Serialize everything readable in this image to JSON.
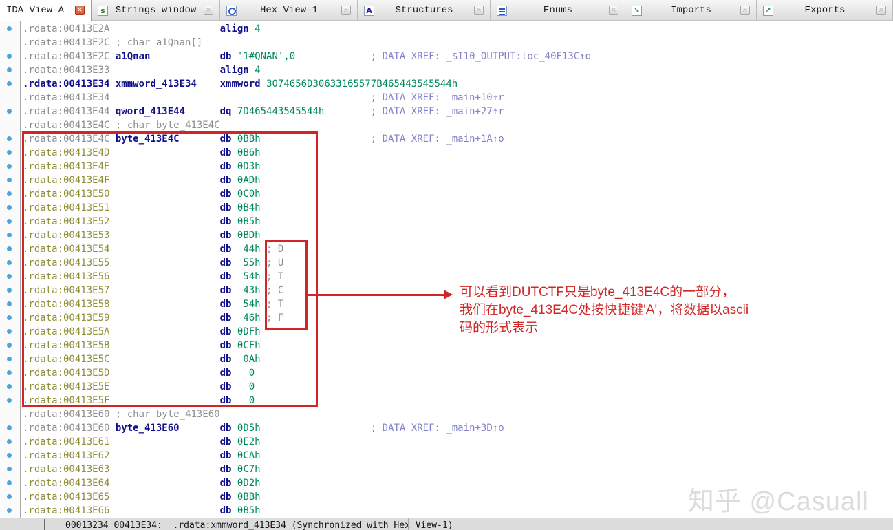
{
  "tabs": [
    {
      "label": "IDA View-A",
      "active": true
    },
    {
      "label": "Strings window",
      "active": false
    },
    {
      "label": "Hex View-1",
      "active": false
    },
    {
      "label": "Structures",
      "active": false
    },
    {
      "label": "Enums",
      "active": false
    },
    {
      "label": "Imports",
      "active": false
    },
    {
      "label": "Exports",
      "active": false
    }
  ],
  "icons": {
    "close": "×",
    "strings": "s",
    "structures": "A",
    "imports": "↘",
    "exports": "↗"
  },
  "listing": {
    "lines": [
      {
        "a": ".rdata:00413E2A",
        "ac": "g",
        "m": "align",
        "o": "4",
        "d": true
      },
      {
        "a": ".rdata:00413E2C",
        "ac": "g",
        "c": "; char a1Qnan[]"
      },
      {
        "a": ".rdata:00413E2C",
        "ac": "g",
        "l": "a1Qnan",
        "m": "db",
        "o": "'1#QNAN',0",
        "x": "; DATA XREF: _$I10_OUTPUT:loc_40F13C↑o",
        "d": true
      },
      {
        "a": ".rdata:00413E33",
        "ac": "g",
        "m": "align",
        "o": "4",
        "d": true
      },
      {
        "a": ".rdata:00413E34",
        "ac": "n",
        "l": "xmmword_413E34",
        "m": "xmmword",
        "o": "3074656D30633165577B465443545544h",
        "d": true
      },
      {
        "a": ".rdata:00413E34",
        "ac": "g",
        "x": "; DATA XREF: _main+10↑r"
      },
      {
        "a": ".rdata:00413E44",
        "ac": "g",
        "l": "qword_413E44",
        "m": "dq",
        "o": "7D465443545544h",
        "x": "; DATA XREF: _main+27↑r",
        "d": true
      },
      {
        "a": ".rdata:00413E4C",
        "ac": "g",
        "c": "; char byte_413E4C"
      },
      {
        "a": ".rdata:00413E4C",
        "ac": "g",
        "l": "byte_413E4C",
        "m": "db",
        "o": "0BBh",
        "p": true,
        "x": "; DATA XREF: _main+1A↑o",
        "d": true
      },
      {
        "a": ".rdata:00413E4D",
        "ac": "o",
        "m": "db",
        "o": "0B6h",
        "p": true,
        "d": true
      },
      {
        "a": ".rdata:00413E4E",
        "ac": "o",
        "m": "db",
        "o": "0D3h",
        "p": true,
        "d": true
      },
      {
        "a": ".rdata:00413E4F",
        "ac": "o",
        "m": "db",
        "o": "0ADh",
        "p": true,
        "d": true
      },
      {
        "a": ".rdata:00413E50",
        "ac": "o",
        "m": "db",
        "o": "0C0h",
        "p": true,
        "d": true
      },
      {
        "a": ".rdata:00413E51",
        "ac": "o",
        "m": "db",
        "o": "0B4h",
        "p": true,
        "d": true
      },
      {
        "a": ".rdata:00413E52",
        "ac": "o",
        "m": "db",
        "o": "0B5h",
        "p": true,
        "d": true
      },
      {
        "a": ".rdata:00413E53",
        "ac": "o",
        "m": "db",
        "o": "0BDh",
        "p": true,
        "d": true
      },
      {
        "a": ".rdata:00413E54",
        "ac": "o",
        "m": "db",
        "o": "44h",
        "p": true,
        "as": "; D",
        "d": true
      },
      {
        "a": ".rdata:00413E55",
        "ac": "o",
        "m": "db",
        "o": "55h",
        "p": true,
        "as": "; U",
        "d": true
      },
      {
        "a": ".rdata:00413E56",
        "ac": "o",
        "m": "db",
        "o": "54h",
        "p": true,
        "as": "; T",
        "d": true
      },
      {
        "a": ".rdata:00413E57",
        "ac": "o",
        "m": "db",
        "o": "43h",
        "p": true,
        "as": "; C",
        "d": true
      },
      {
        "a": ".rdata:00413E58",
        "ac": "o",
        "m": "db",
        "o": "54h",
        "p": true,
        "as": "; T",
        "d": true
      },
      {
        "a": ".rdata:00413E59",
        "ac": "o",
        "m": "db",
        "o": "46h",
        "p": true,
        "as": "; F",
        "d": true
      },
      {
        "a": ".rdata:00413E5A",
        "ac": "o",
        "m": "db",
        "o": "0DFh",
        "p": true,
        "d": true
      },
      {
        "a": ".rdata:00413E5B",
        "ac": "o",
        "m": "db",
        "o": "0CFh",
        "p": true,
        "d": true
      },
      {
        "a": ".rdata:00413E5C",
        "ac": "o",
        "m": "db",
        "o": "0Ah",
        "p": true,
        "d": true
      },
      {
        "a": ".rdata:00413E5D",
        "ac": "o",
        "m": "db",
        "o": "0",
        "p": true,
        "d": true
      },
      {
        "a": ".rdata:00413E5E",
        "ac": "o",
        "m": "db",
        "o": "0",
        "p": true,
        "d": true
      },
      {
        "a": ".rdata:00413E5F",
        "ac": "o",
        "m": "db",
        "o": "0",
        "p": true,
        "d": true
      },
      {
        "a": ".rdata:00413E60",
        "ac": "g",
        "c": "; char byte_413E60"
      },
      {
        "a": ".rdata:00413E60",
        "ac": "g",
        "l": "byte_413E60",
        "m": "db",
        "o": "0D5h",
        "p": true,
        "x": "; DATA XREF: _main+3D↑o",
        "d": true
      },
      {
        "a": ".rdata:00413E61",
        "ac": "o",
        "m": "db",
        "o": "0E2h",
        "p": true,
        "d": true
      },
      {
        "a": ".rdata:00413E62",
        "ac": "o",
        "m": "db",
        "o": "0CAh",
        "p": true,
        "d": true
      },
      {
        "a": ".rdata:00413E63",
        "ac": "o",
        "m": "db",
        "o": "0C7h",
        "p": true,
        "d": true
      },
      {
        "a": ".rdata:00413E64",
        "ac": "o",
        "m": "db",
        "o": "0D2h",
        "p": true,
        "d": true
      },
      {
        "a": ".rdata:00413E65",
        "ac": "o",
        "m": "db",
        "o": "0BBh",
        "p": true,
        "d": true
      },
      {
        "a": ".rdata:00413E66",
        "ac": "o",
        "m": "db",
        "o": "0B5h",
        "p": true,
        "d": true
      }
    ]
  },
  "annotations": {
    "note_lines": [
      "可以看到DUTCTF只是byte_413E4C的一部分，",
      "我们在byte_413E4C处按快捷键'A'，将数据以ascii",
      "码的形式表示"
    ]
  },
  "watermark": "知乎 @Casuall",
  "statusbar": {
    "text": "00013234 00413E34:  .rdata:xmmword_413E34 (Synchronized with Hex View-1)"
  },
  "colors": {
    "address_gray": "#8e8e8e",
    "address_olive": "#8f8f38",
    "keyword_navy": "#10108c",
    "value_green": "#008a5c",
    "xref_purple": "#8484c8",
    "annotation_red": "#d02626",
    "linemark_blue": "#4ba6d9"
  }
}
